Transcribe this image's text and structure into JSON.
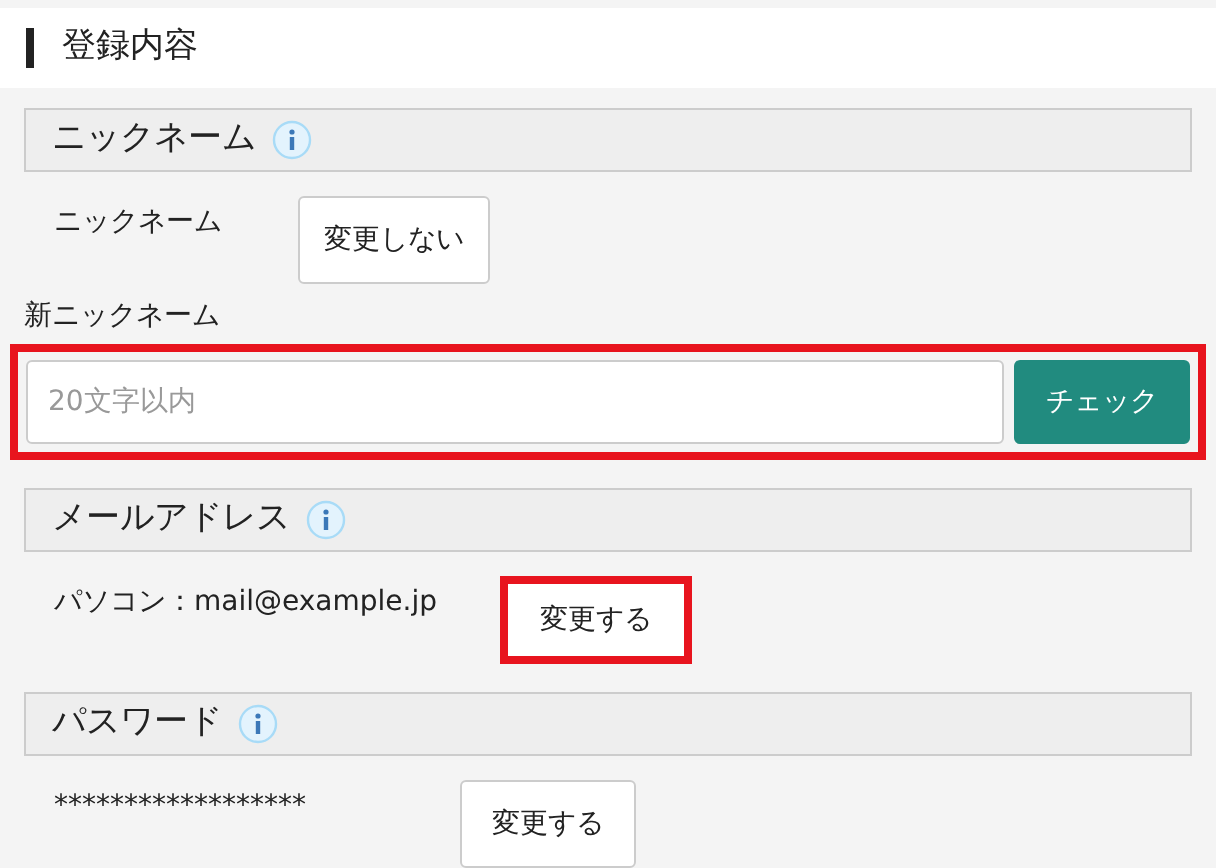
{
  "title": "登録内容",
  "sections": [
    {
      "heading": "ニックネーム",
      "rows": [
        {
          "label": "ニックネーム",
          "button": {
            "label": "変更しない",
            "highlighted": false
          }
        }
      ],
      "new_field": {
        "label": "新ニックネーム",
        "placeholder": "20文字以内",
        "button": "チェック",
        "highlighted": true
      }
    },
    {
      "heading": "メールアドレス",
      "rows": [
        {
          "label": "パソコン：mail@example.jp",
          "button": {
            "label": "変更する",
            "highlighted": true
          }
        }
      ]
    },
    {
      "heading": "パスワード",
      "rows": [
        {
          "label": "******************",
          "button": {
            "label": "変更する",
            "highlighted": false
          }
        }
      ]
    }
  ]
}
